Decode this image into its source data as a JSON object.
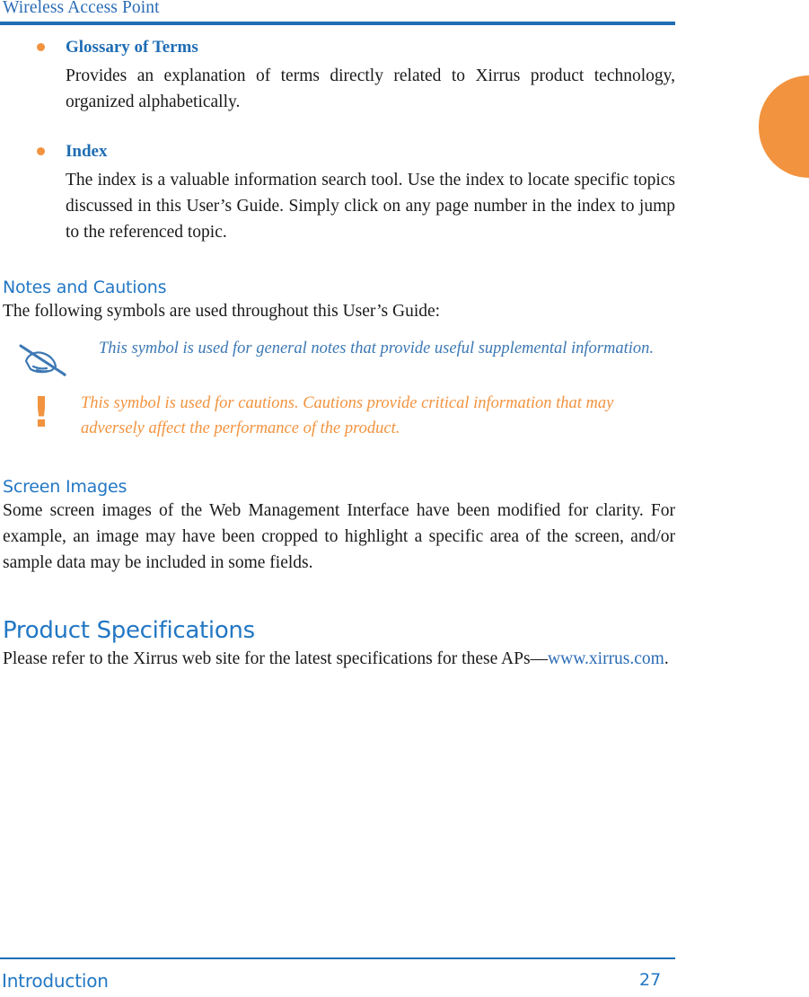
{
  "header": {
    "running_head": "Wireless Access Point"
  },
  "edge_tab": {
    "color": "#f2933f"
  },
  "bullets": [
    {
      "title": "Glossary of Terms",
      "body": "Provides an explanation of terms directly related to Xirrus product technology, organized alphabetically."
    },
    {
      "title": "Index",
      "body": "The index is a valuable information search tool. Use the index to locate specific topics discussed in this User’s Guide. Simply click on any page number in the index to jump to the referenced topic."
    }
  ],
  "sections": [
    {
      "id": "notes-and-cautions",
      "heading": "Notes and Cautions",
      "intro": "The following symbols are used throughout this User’s Guide:",
      "note": {
        "icon": "hand-writing-note-icon",
        "text": "This symbol is used for general notes that provide useful supplemental information."
      },
      "caution": {
        "icon": "exclamation-caution-icon",
        "glyph": "!",
        "text": "This symbol is used for cautions. Cautions provide critical information that may adversely affect the performance of the product."
      }
    },
    {
      "id": "screen-images",
      "heading": "Screen Images",
      "body": "Some screen images of the Web Management Interface have been modified for clarity. For example, an image may have been cropped to highlight a specific area of the screen, and/or sample data may be included in some fields."
    },
    {
      "id": "product-specifications",
      "heading": "Product Specifications",
      "body_before_link": "Please refer to the Xirrus web site for the latest specifications for these APs—",
      "link_text": "www.xirrus.com",
      "body_after_link": "."
    }
  ],
  "footer": {
    "chapter": "Introduction",
    "page_number": "27"
  },
  "colors": {
    "brand_blue": "#1f6db4",
    "heading_blue": "#2277c4",
    "note_blue": "#3c78b4",
    "accent_orange": "#f2933f"
  }
}
